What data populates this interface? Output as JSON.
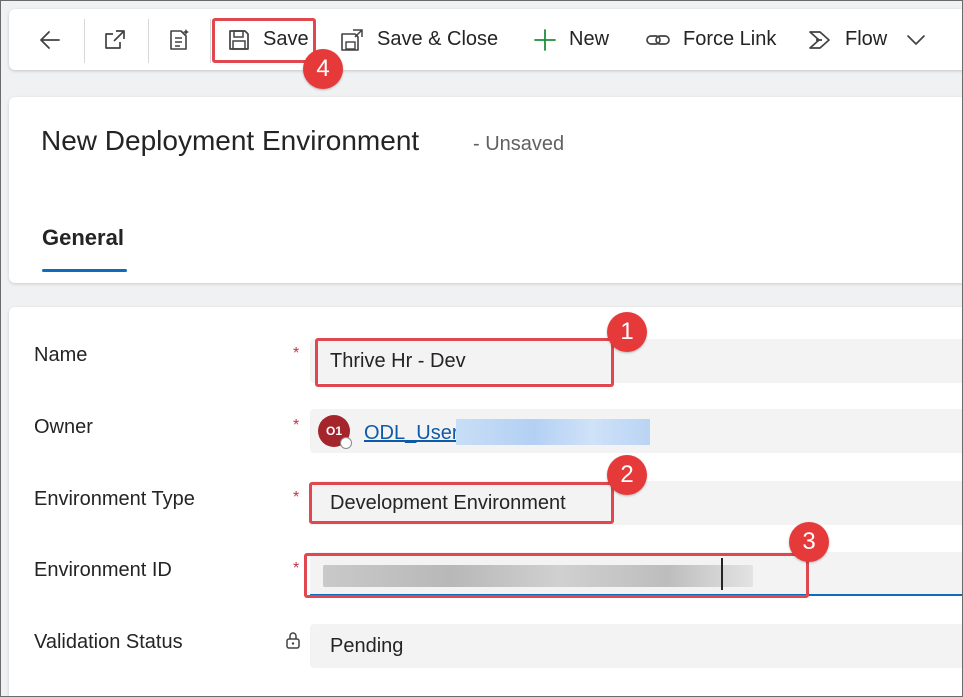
{
  "toolbar": {
    "save_label": "Save",
    "save_close_label": "Save & Close",
    "new_label": "New",
    "force_link_label": "Force Link",
    "flow_label": "Flow"
  },
  "header": {
    "title": "New Deployment Environment",
    "status": "- Unsaved",
    "tabs": [
      {
        "label": "General"
      }
    ]
  },
  "form": {
    "name": {
      "label": "Name",
      "required": "*",
      "value": "Thrive Hr - Dev"
    },
    "owner": {
      "label": "Owner",
      "required": "*",
      "value": "ODL_User",
      "initials": "O1"
    },
    "environment_type": {
      "label": "Environment Type",
      "required": "*",
      "value": "Development Environment"
    },
    "environment_id": {
      "label": "Environment ID",
      "required": "*",
      "value": ""
    },
    "validation_status": {
      "label": "Validation Status",
      "value": "Pending",
      "icon": "lock-icon"
    }
  },
  "annotations": [
    "1",
    "2",
    "3",
    "4"
  ],
  "colors": {
    "accent": "#0f6cbd",
    "annotation": "#e63a3a",
    "required": "#c4314b",
    "avatar": "#a4262c"
  }
}
